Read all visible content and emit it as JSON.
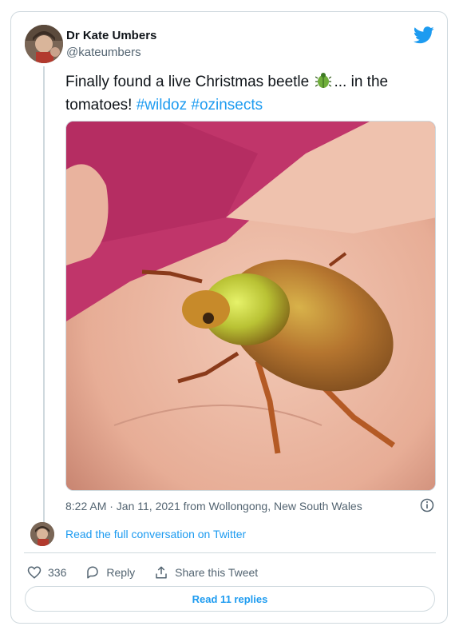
{
  "author": {
    "name": "Dr Kate Umbers",
    "handle": "@kateumbers"
  },
  "tweet": {
    "text_before": "Finally found a live Christmas beetle",
    "text_after": "... in the tomatoes!",
    "hashtags": [
      "#wildoz",
      "#ozinsects"
    ],
    "emoji": "beetle-emoji"
  },
  "meta": {
    "timestamp": "8:22 AM · Jan 11, 2021 from Wollongong, New South Wales"
  },
  "conversation_link": "Read the full conversation on Twitter",
  "actions": {
    "like_count": "336",
    "reply_label": "Reply",
    "share_label": "Share this Tweet"
  },
  "read_replies": "Read 11 replies",
  "colors": {
    "link": "#1d9bf0",
    "text": "#0f1419",
    "muted": "#536471",
    "border": "#cfd9de"
  }
}
